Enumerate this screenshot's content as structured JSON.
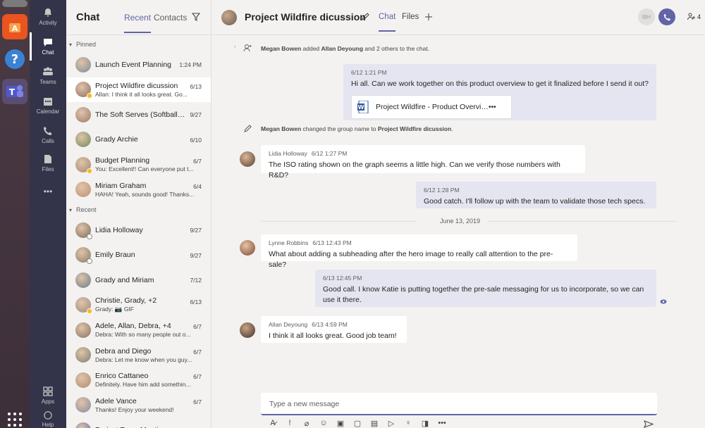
{
  "rail": {
    "items": [
      {
        "label": "Activity"
      },
      {
        "label": "Chat"
      },
      {
        "label": "Teams"
      },
      {
        "label": "Calendar"
      },
      {
        "label": "Calls"
      },
      {
        "label": "Files"
      },
      {
        "label": "Apps"
      },
      {
        "label": "Help"
      }
    ],
    "more": "•••"
  },
  "chat_list": {
    "title": "Chat",
    "tabs": [
      "Recent",
      "Contacts"
    ],
    "pinned_label": "Pinned",
    "recent_label": "Recent",
    "pinned": [
      {
        "name": "Launch Event Planning",
        "preview": "",
        "date": "1:24 PM"
      },
      {
        "name": "Project Wildfire dicussion",
        "preview": "Allan: I think it all looks great. Go...",
        "date": "6/13"
      },
      {
        "name": "The Soft Serves (Softball T...",
        "preview": "",
        "date": "9/27"
      },
      {
        "name": "Grady Archie",
        "preview": "",
        "date": "6/10"
      },
      {
        "name": "Budget Planning",
        "preview": "You: Excellent!! Can everyone put t...",
        "date": "6/7"
      },
      {
        "name": "Miriam Graham",
        "preview": "HAHA! Yeah, sounds good! Thanks...",
        "date": "6/4"
      }
    ],
    "recent": [
      {
        "name": "Lidia Holloway",
        "preview": "",
        "date": "9/27"
      },
      {
        "name": "Emily Braun",
        "preview": "",
        "date": "9/27"
      },
      {
        "name": "Grady and Miriam",
        "preview": "",
        "date": "7/12"
      },
      {
        "name": "Christie, Grady, +2",
        "preview": "Grady: 📷 GIF",
        "date": "6/13"
      },
      {
        "name": "Adele, Allan, Debra, +4",
        "preview": "Debra: With so many people out o...",
        "date": "6/7"
      },
      {
        "name": "Debra and Diego",
        "preview": "Debra: Let me know when you guy...",
        "date": "6/7"
      },
      {
        "name": "Enrico Cattaneo",
        "preview": "Definitely. Have him add somethin...",
        "date": "6/7"
      },
      {
        "name": "Adele Vance",
        "preview": "Thanks! Enjoy your weekend!",
        "date": "6/7"
      },
      {
        "name": "Project Team Meeting",
        "preview": "",
        "date": "6/7"
      }
    ]
  },
  "header": {
    "title": "Project Wildfire dicussion",
    "tabs": [
      "Chat",
      "Files"
    ],
    "participants_count": "4"
  },
  "messages": {
    "sys1": {
      "actor": "Megan Bowen",
      "verb": " added ",
      "target": "Allan Deyoung",
      "rest": " and 2 others to the chat."
    },
    "sys2": {
      "actor": "Megan Bowen",
      "verb": " changed the group name to ",
      "target": "Project Wildfire dicussion",
      "rest": "."
    },
    "m1": {
      "time": "6/12 1:21 PM",
      "text": "Hi all.  Can we work together on this product overview to get it finalized before I send it out?",
      "file": "Project Wildfire - Product Overview.docx",
      "file_more": "•••"
    },
    "m2": {
      "author": "Lidia Holloway",
      "time": "6/12 1:27 PM",
      "text": "The ISO rating shown on the graph seems a little high.  Can we verify those numbers with R&D?"
    },
    "m3": {
      "time": "6/12 1:28 PM",
      "text": "Good catch.  I'll follow up with the team to validate those tech specs."
    },
    "date_divider": "June 13, 2019",
    "m4": {
      "author": "Lynne Robbins",
      "time": "6/13 12:43 PM",
      "text": "What about adding a subheading after the hero image to really call attention to the pre-sale?"
    },
    "m5": {
      "time": "6/13 12:45 PM",
      "text": "Good call.  I know Katie is putting together the pre-sale messaging for us to incorporate, so we can use it there."
    },
    "m6": {
      "author": "Allan Deyoung",
      "time": "6/13 4:59 PM",
      "text": "I think it all looks great.  Good job team!"
    }
  },
  "composer": {
    "placeholder": "Type a new message"
  },
  "colors": {
    "accent": "#6264a7",
    "rail": "#33344a",
    "self_bubble": "#e5e5f1",
    "presence_available": "#92c353"
  }
}
